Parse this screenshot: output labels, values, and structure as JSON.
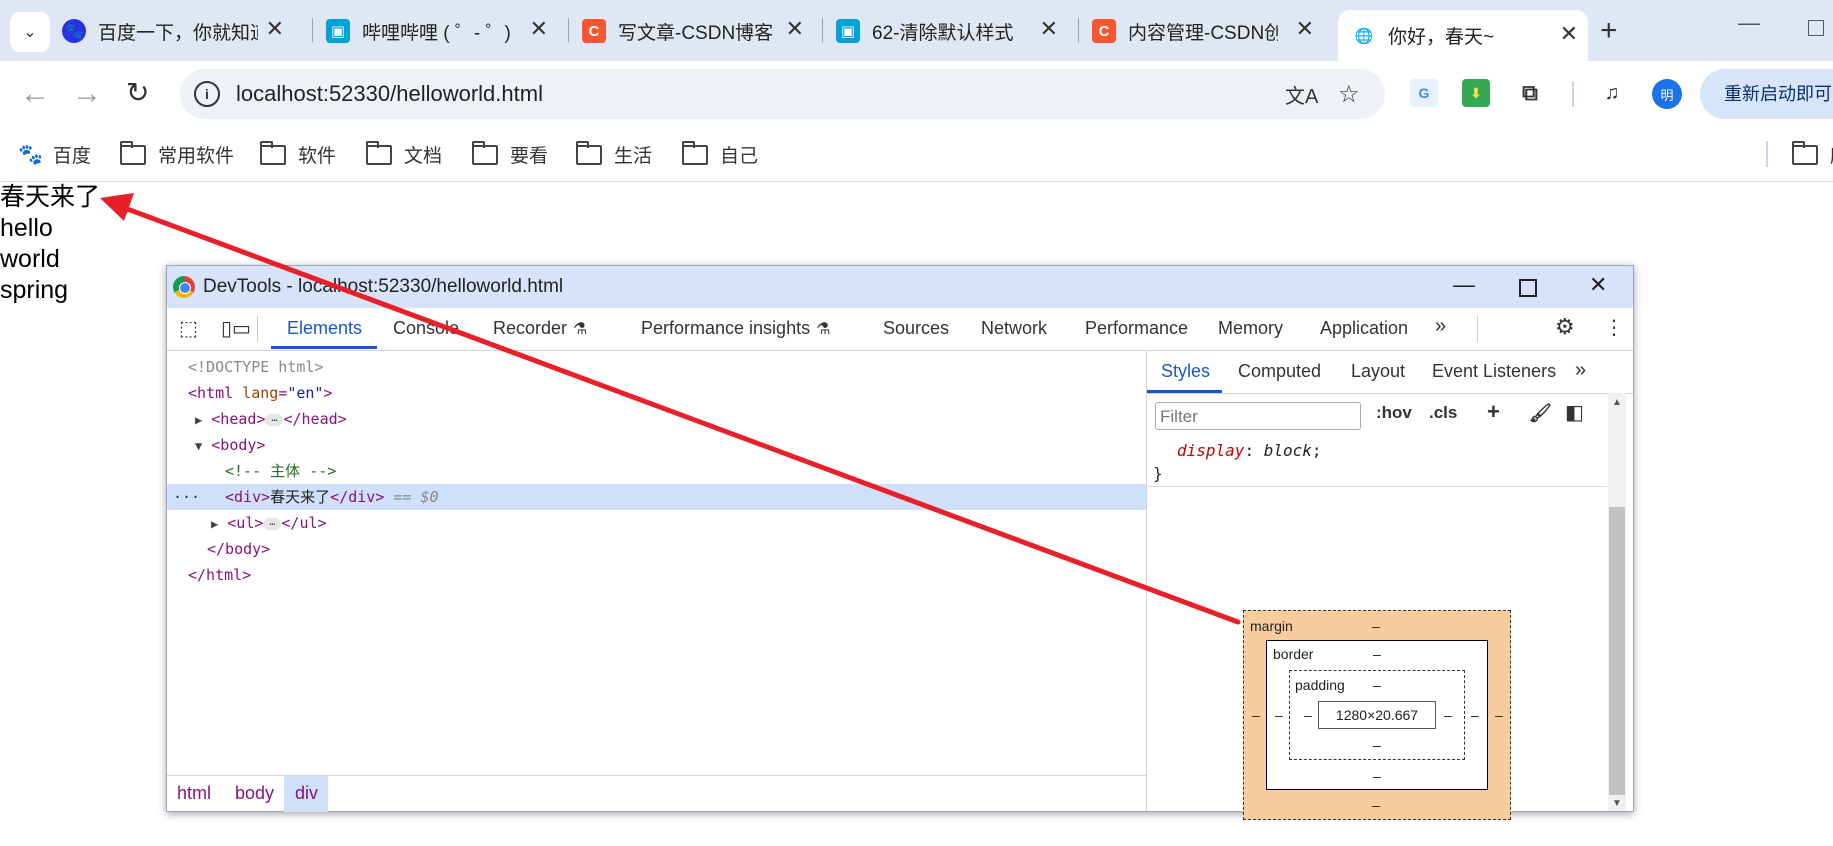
{
  "tabs": [
    {
      "title": "百度一下，你就知道",
      "icon": "baidu-icon",
      "color": "#2932e1"
    },
    {
      "title": "哔哩哔哩 ( ゜- ゜)つロ",
      "icon": "bilibili-icon",
      "color": "#00a1d6"
    },
    {
      "title": "写文章-CSDN博客",
      "icon": "csdn-icon",
      "color": "#fc5531"
    },
    {
      "title": "62-清除默认样式",
      "icon": "bilibili-icon",
      "color": "#00a1d6"
    },
    {
      "title": "内容管理-CSDN创",
      "icon": "csdn-icon",
      "color": "#fc5531"
    },
    {
      "title": "你好，春天~",
      "icon": "globe-icon",
      "color": "#1a73e8"
    }
  ],
  "address": {
    "url": "localhost:52330/helloworld.html"
  },
  "profile": {
    "initial": "明"
  },
  "relaunch_label": "重新启动即可",
  "bookmarks": [
    {
      "label": "百度"
    },
    {
      "label": "常用软件"
    },
    {
      "label": "软件"
    },
    {
      "label": "文档"
    },
    {
      "label": "要看"
    },
    {
      "label": "生活"
    },
    {
      "label": "自己"
    },
    {
      "label": "所"
    }
  ],
  "page_content": {
    "lines": [
      "春天来了",
      "hello",
      "world",
      "spring"
    ]
  },
  "devtools": {
    "title": "DevTools - localhost:52330/helloworld.html",
    "tabs": [
      "Elements",
      "Console",
      "Recorder",
      "Performance insights",
      "Sources",
      "Network",
      "Performance",
      "Memory",
      "Application"
    ],
    "elements": {
      "doctype": "<!DOCTYPE html>",
      "html_open": "<html",
      "html_attr": " lang",
      "html_attr_val": "\"en\"",
      "gt": ">",
      "head_open": "<head>",
      "head_close": "</head>",
      "body_open": "<body>",
      "comment": "<!-- 主体 -->",
      "div_open": "<div>",
      "div_text": "春天来了",
      "div_close": "</div>",
      "div_meta": " == $0",
      "ul_open": "<ul>",
      "ul_close": "</ul>",
      "body_close": "</body>",
      "html_close": "</html>",
      "ellipsis": "…"
    },
    "breadcrumbs": [
      "html",
      "body",
      "div"
    ],
    "side_tabs": [
      "Styles",
      "Computed",
      "Layout",
      "Event Listeners"
    ],
    "filter_placeholder": "Filter",
    "hov": ":hov",
    "cls": ".cls",
    "css": {
      "property": "display",
      "value": "block",
      "close": "}"
    },
    "box_model": {
      "margin_label": "margin",
      "border_label": "border",
      "padding_label": "padding",
      "content": "1280×20.667",
      "dash": "–"
    }
  },
  "annotation": {
    "color": "#e8202a"
  }
}
